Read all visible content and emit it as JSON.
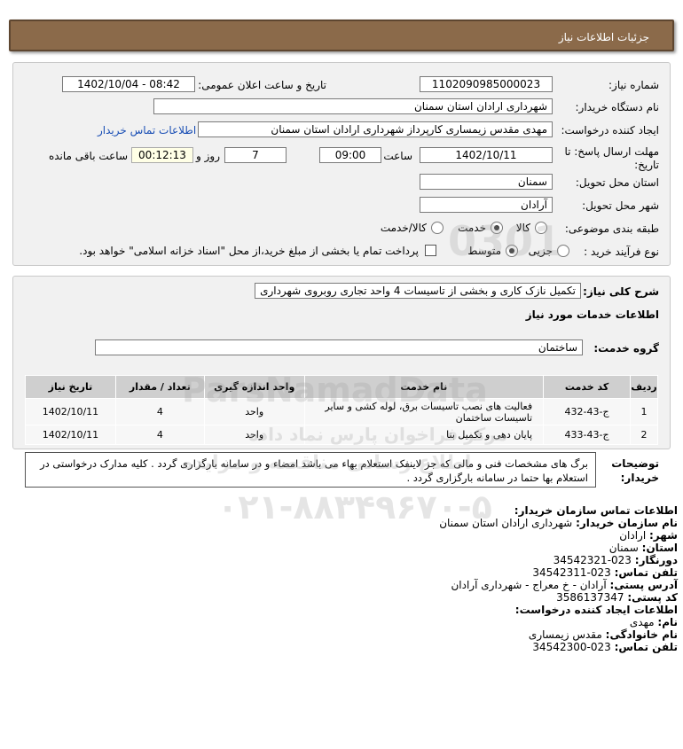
{
  "header": {
    "title": "جزئیات اطلاعات نیاز"
  },
  "form": {
    "need_number_label": "شماره نیاز:",
    "need_number": "1102090985000023",
    "announce_label": "تاریخ و ساعت اعلان عمومی:",
    "announce_value": "1402/10/04 - 08:42",
    "buyer_org_label": "نام دستگاه خریدار:",
    "buyer_org": "شهرداری ارادان استان سمنان",
    "creator_label": "ایجاد کننده درخواست:",
    "creator": "مهدی مقدس زیمساری کارپرداز شهرداری ارادان استان سمنان",
    "contact_link": "اطلاعات تماس خریدار",
    "deadline_label_1": "مهلت ارسال پاسخ: تا",
    "deadline_label_2": "تاریخ:",
    "deadline_date": "1402/10/11",
    "time_label": "ساعت",
    "deadline_time": "09:00",
    "days_value": "7",
    "days_label": "روز و",
    "remaining_time": "00:12:13",
    "remaining_label": "ساعت باقی مانده",
    "province_label": "استان محل تحویل:",
    "province": "سمنان",
    "city_label": "شهر محل تحویل:",
    "city": "آرادان",
    "category_label": "طبقه بندی موضوعی:",
    "category_options": [
      "کالا",
      "خدمت",
      "کالا/خدمت"
    ],
    "category_selected": "خدمت",
    "process_label": "نوع فرآیند خرید :",
    "process_options": [
      "جزیی",
      "متوسط"
    ],
    "process_selected": "متوسط",
    "payment_note": "پرداخت تمام یا بخشی از مبلغ خرید،از محل \"اسناد خزانه اسلامی\" خواهد بود."
  },
  "summary": {
    "label": "شرح کلی نیاز:",
    "text": "تکمیل نازک کاری و بخشی از تاسیسات 4 واحد تجاری روبروی شهرداری",
    "services_heading": "اطلاعات خدمات مورد نیاز",
    "service_group_label": "گروه خدمت:",
    "service_group": "ساختمان"
  },
  "table": {
    "headers": [
      "ردیف",
      "کد خدمت",
      "نام خدمت",
      "واحد اندازه گیری",
      "تعداد / مقدار",
      "تاریخ نیاز"
    ],
    "rows": [
      {
        "row": "1",
        "code": "ج-43-432",
        "name": "فعالیت های نصب تاسیسات برق، لوله کشی و سایر تاسیسات ساختمان",
        "unit": "واحد",
        "qty": "4",
        "date": "1402/10/11"
      },
      {
        "row": "2",
        "code": "ج-43-433",
        "name": "پایان دهی و تکمیل بنا",
        "unit": "واحد",
        "qty": "4",
        "date": "1402/10/11"
      }
    ]
  },
  "buyer_notes": {
    "label_1": "توضیحات",
    "label_2": "خریدار:",
    "text": "برگ های مشخصات فنی و مالی که جز لاینفک استعلام بهاء می باشد امضاء و در سامانه بارگزاری گردد . کلیه مدارک درخواستی در استعلام بها حتما در سامانه بارگزاری گردد ."
  },
  "contact": {
    "heading": "اطلاعات تماس سازمان خریدار:",
    "org_label": "نام سازمان خریدار:",
    "org": "شهرداری ارادان استان سمنان",
    "city_label": "شهر:",
    "city": "ارادان",
    "province_label": "استان:",
    "province": "سمنان",
    "fax_label": "دورنگار:",
    "fax": "023-34542321",
    "phone_label": "تلفن تماس:",
    "phone": "023-34542311",
    "address_label": "آدرس پستی:",
    "address": "آرادان - خ معراج - شهرداری آرادان",
    "postal_label": "کد پستی:",
    "postal": "3586137347",
    "creator_heading": "اطلاعات ایجاد کننده درخواست:",
    "first_name_label": "نام:",
    "first_name": "مهدی",
    "last_name_label": "نام خانوادگی:",
    "last_name": "مقدس زیمساری",
    "creator_phone_label": "تلفن تماس:",
    "creator_phone": "023-34542300"
  },
  "watermark": {
    "brand": "ParsNamadData",
    "tagline": "مرکز فراخوان پارس نماد داده",
    "tagline2": "اطلاع رسانی مناقصه و مزایده",
    "phone": "۰۲۱-۸۸۳۴۹۶۷۰-۵",
    "number": "0301"
  },
  "colors": {
    "header_bg": "#8b6a4a",
    "panel_bg": "#f1f1f1",
    "link": "#1a4fb5",
    "table_header": "#cfcfcf"
  }
}
